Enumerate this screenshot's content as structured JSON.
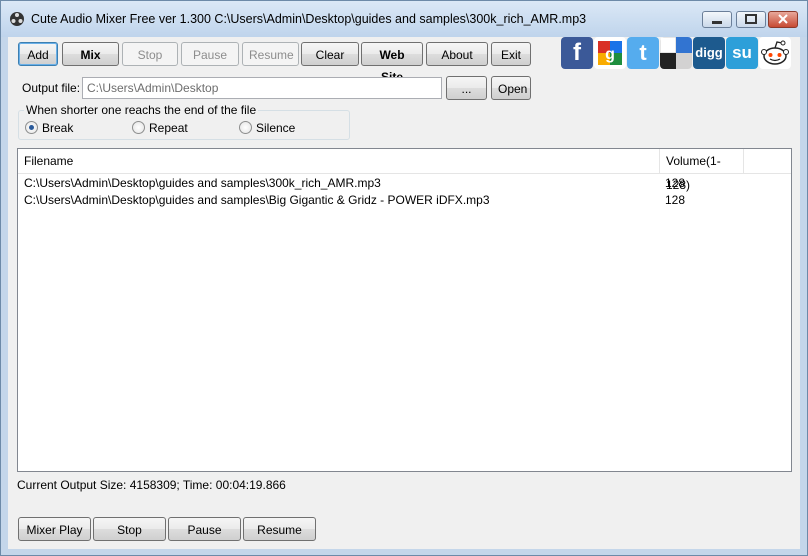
{
  "window": {
    "title": "Cute Audio Mixer Free ver 1.300  C:\\Users\\Admin\\Desktop\\guides and samples\\300k_rich_AMR.mp3"
  },
  "toolbar": {
    "add": "Add",
    "mix": "Mix",
    "stop": "Stop",
    "pause": "Pause",
    "resume": "Resume",
    "clear": "Clear",
    "website": "Web Site",
    "about": "About",
    "exit": "Exit"
  },
  "social": [
    {
      "name": "facebook-icon",
      "glyph": "f",
      "color": "#3b5998"
    },
    {
      "name": "google-icon",
      "glyph": "g",
      "color": "#dd4b39"
    },
    {
      "name": "twitter-icon",
      "glyph": "t",
      "color": "#55acee"
    },
    {
      "name": "delicious-icon",
      "glyph": "",
      "color": "#3274d1"
    },
    {
      "name": "digg-icon",
      "glyph": "digg",
      "color": "#1d5a8e"
    },
    {
      "name": "stumbleupon-icon",
      "glyph": "su",
      "color": "#2d9fd9"
    },
    {
      "name": "reddit-icon",
      "glyph": "",
      "color": "#ffffff"
    }
  ],
  "output": {
    "label": "Output file:",
    "value": "C:\\Users\\Admin\\Desktop",
    "browse": "...",
    "open": "Open"
  },
  "shorter": {
    "legend": "When shorter one reachs the end of the file",
    "options": [
      "Break",
      "Repeat",
      "Silence"
    ],
    "selected": "Break"
  },
  "list": {
    "columns": [
      "Filename",
      "Volume(1-128)"
    ],
    "rows": [
      {
        "file": "C:\\Users\\Admin\\Desktop\\guides and samples\\300k_rich_AMR.mp3",
        "volume": "128"
      },
      {
        "file": "C:\\Users\\Admin\\Desktop\\guides and samples\\Big Gigantic & Gridz - POWER iDFX.mp3",
        "volume": "128"
      }
    ]
  },
  "status": "Current Output Size: 4158309; Time: 00:04:19.866",
  "bottom": {
    "mixer_play": "Mixer Play",
    "stop": "Stop",
    "pause": "Pause",
    "resume": "Resume"
  }
}
